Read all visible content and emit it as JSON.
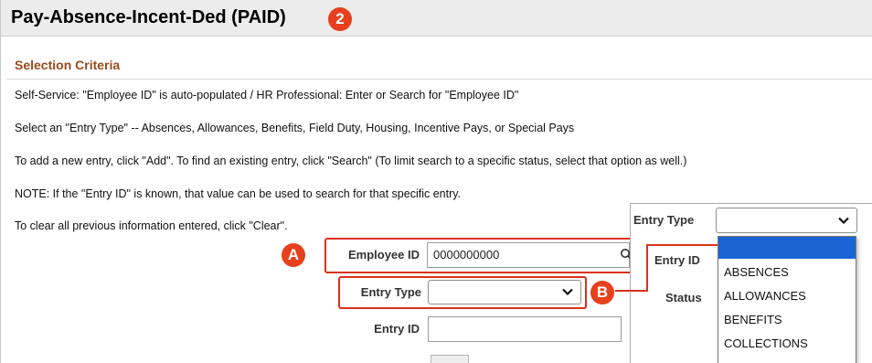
{
  "header": {
    "title": "Pay-Absence-Incent-Ded (PAID)",
    "step_badge": "2"
  },
  "selection": {
    "title": "Selection Criteria",
    "instructions": [
      "Self-Service: \"Employee ID\" is auto-populated / HR Professional: Enter or Search for \"Employee ID\"",
      "Select an \"Entry Type\" -- Absences, Allowances, Benefits, Field Duty, Housing, Incentive Pays, or Special Pays",
      "To add a new entry, click \"Add\". To find an existing entry, click \"Search\" (To limit search to a specific status, select that option as well.)",
      "NOTE: If the \"Entry ID\" is known, that value can be used to search for that specific entry.",
      "To clear all previous information entered, click \"Clear\"."
    ]
  },
  "form": {
    "employee_id": {
      "label": "Employee ID",
      "value": "0000000000"
    },
    "entry_type": {
      "label": "Entry Type",
      "value": ""
    },
    "entry_id": {
      "label": "Entry ID",
      "value": ""
    }
  },
  "callouts": {
    "a": "A",
    "b": "B"
  },
  "dropdown": {
    "entry_type_label": "Entry Type",
    "entry_id_label": "Entry ID",
    "status_label": "Status",
    "selected": "",
    "options": [
      "",
      "ABSENCES",
      "ALLOWANCES",
      "BENEFITS",
      "COLLECTIONS"
    ]
  },
  "colors": {
    "accent": "#e8401e",
    "callout_border": "#d9321c",
    "section_title": "#9a4a1c",
    "selected_option": "#1a64d6"
  },
  "icons": {
    "search": "search-icon",
    "chevron": "chevron-down-icon"
  }
}
